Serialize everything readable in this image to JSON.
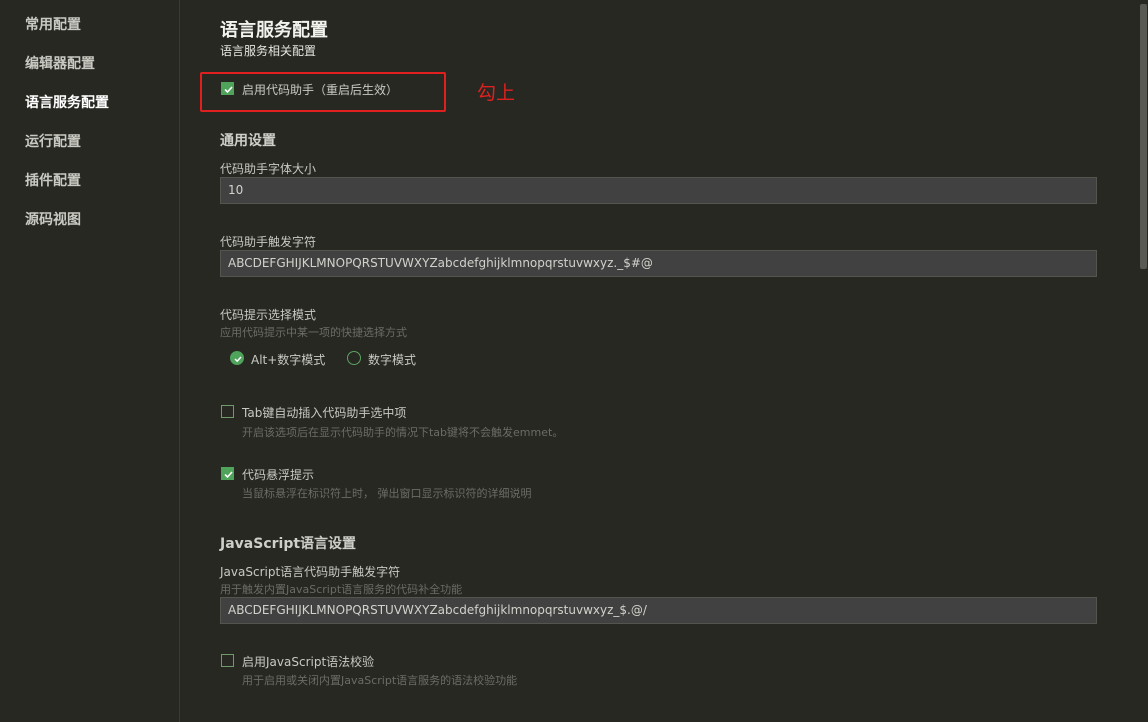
{
  "sidebar": {
    "items": [
      {
        "label": "常用配置"
      },
      {
        "label": "编辑器配置"
      },
      {
        "label": "语言服务配置"
      },
      {
        "label": "运行配置"
      },
      {
        "label": "插件配置"
      },
      {
        "label": "源码视图"
      }
    ],
    "active_index": 2
  },
  "page": {
    "title": "语言服务配置",
    "subtitle": "语言服务相关配置"
  },
  "enable_assistant": {
    "label": "启用代码助手（重启后生效）",
    "checked": true
  },
  "annotation": {
    "text": "勾上",
    "color": "#e0201e"
  },
  "general": {
    "title": "通用设置",
    "font_size": {
      "label": "代码助手字体大小",
      "value": "10"
    },
    "trigger_chars": {
      "label": "代码助手触发字符",
      "value": "ABCDEFGHIJKLMNOPQRSTUVWXYZabcdefghijklmnopqrstuvwxyz._$#@"
    },
    "select_mode": {
      "label": "代码提示选择模式",
      "desc": "应用代码提示中某一项的快捷选择方式",
      "options": [
        {
          "label": "Alt+数字模式",
          "selected": true
        },
        {
          "label": "数字模式",
          "selected": false
        }
      ]
    },
    "tab_insert": {
      "label": "Tab键自动插入代码助手选中项",
      "desc": "开启该选项后在显示代码助手的情况下tab键将不会触发emmet。",
      "checked": false
    },
    "hover_hint": {
      "label": "代码悬浮提示",
      "desc": "当鼠标悬浮在标识符上时， 弹出窗口显示标识符的详细说明",
      "checked": true
    }
  },
  "javascript": {
    "title": "JavaScript语言设置",
    "trigger_chars": {
      "label": "JavaScript语言代码助手触发字符",
      "desc": "用于触发内置JavaScript语言服务的代码补全功能",
      "value": "ABCDEFGHIJKLMNOPQRSTUVWXYZabcdefghijklmnopqrstuvwxyz_$.@/"
    },
    "syntax_check": {
      "label": "启用JavaScript语法校验",
      "desc": "用于启用或关闭内置JavaScript语言服务的语法校验功能",
      "checked": false
    }
  },
  "colors": {
    "accent": "#4fa35a",
    "background": "#272822",
    "input_bg": "#414141"
  }
}
